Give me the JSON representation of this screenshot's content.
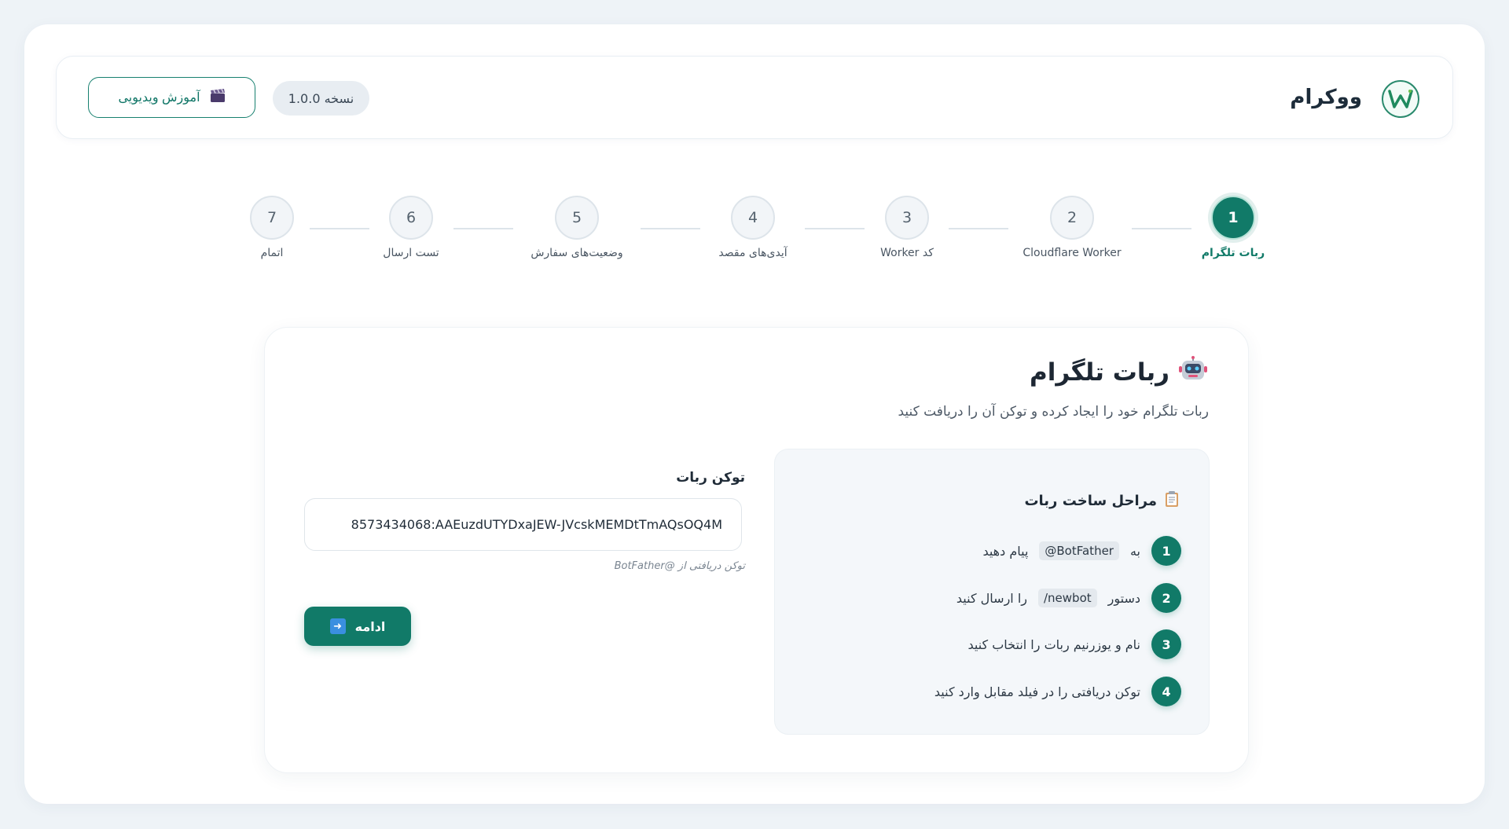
{
  "header": {
    "brand": "ووکرام",
    "version": "نسخه 1.0.0",
    "video_button": "آموزش ویدیویی"
  },
  "stepper": {
    "steps": [
      {
        "number": "1",
        "label": "ربات تلگرام",
        "active": true
      },
      {
        "number": "2",
        "label": "Cloudflare Worker",
        "active": false
      },
      {
        "number": "3",
        "label": "کد Worker",
        "active": false
      },
      {
        "number": "4",
        "label": "آیدی‌های مقصد",
        "active": false
      },
      {
        "number": "5",
        "label": "وضعیت‌های سفارش",
        "active": false
      },
      {
        "number": "6",
        "label": "تست ارسال",
        "active": false
      },
      {
        "number": "7",
        "label": "اتمام",
        "active": false
      }
    ]
  },
  "card": {
    "title": "ربات تلگرام",
    "subtitle": "ربات تلگرام خود را ایجاد کرده و توکن آن را دریافت کنید",
    "instructions": {
      "title": "مراحل ساخت ربات",
      "items": [
        {
          "number": "1",
          "before": "به",
          "code": "@BotFather",
          "after": "پیام دهید"
        },
        {
          "number": "2",
          "before": "دستور",
          "code": "/newbot",
          "after": "را ارسال کنید"
        },
        {
          "number": "3",
          "text": "نام و یوزرنیم ربات را انتخاب کنید"
        },
        {
          "number": "4",
          "text": "توکن دریافتی را در فیلد مقابل وارد کنید"
        }
      ]
    },
    "token_field": {
      "label": "توکن ربات",
      "value": "8573434068:AAEuzdUTYDxaJEW-JVcskMEMDtTmAQsOQ4M",
      "hint": "توکن دریافتی از @BotFather"
    },
    "continue_button": "ادامه"
  },
  "colors": {
    "primary": "#117a68",
    "background": "#eef3f7",
    "info_box": "#f4f7fa"
  }
}
